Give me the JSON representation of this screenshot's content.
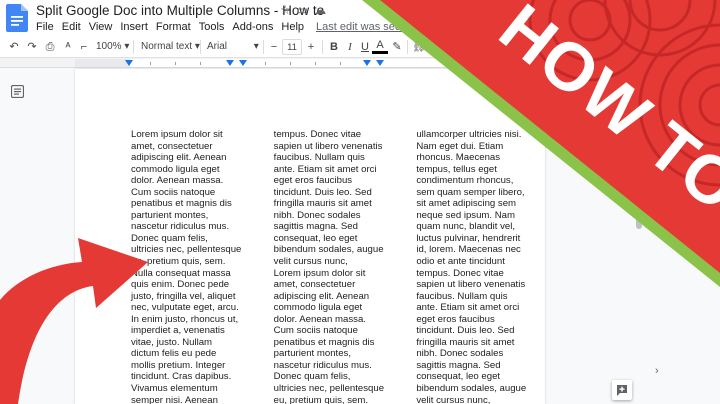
{
  "window": {
    "title": "Split Google Doc into Multiple Columns - How to",
    "star_icon": "star-icon",
    "move_icon": "folder-move-icon",
    "cloud_icon": "cloud-saved-icon"
  },
  "menu": {
    "items": [
      "File",
      "Edit",
      "View",
      "Insert",
      "Format",
      "Tools",
      "Add-ons",
      "Help"
    ],
    "last_edit": "Last edit was seconds ago"
  },
  "toolbar": {
    "zoom": "100%",
    "style": "Normal text",
    "font": "Arial",
    "font_size": "11",
    "minus": "−",
    "plus": "+",
    "bold": "B",
    "italic": "I",
    "underline": "U",
    "text_color": "A"
  },
  "document": {
    "columns": [
      [
        "Lorem ipsum dolor sit",
        "amet, consectetuer",
        "adipiscing elit. Aenean",
        "commodo ligula eget",
        "dolor. Aenean massa.",
        "Cum sociis natoque",
        "penatibus et magnis dis",
        "parturient montes,",
        "nascetur ridiculus mus.",
        "Donec quam felis,",
        "ultricies nec, pellentesque",
        "eu, pretium quis, sem.",
        "Nulla consequat massa",
        "quis enim. Donec pede",
        "justo, fringilla vel, aliquet",
        "nec, vulputate eget, arcu.",
        "In enim justo, rhoncus ut,",
        "imperdiet a, venenatis",
        "vitae, justo. Nullam",
        "dictum felis eu pede",
        "mollis pretium. Integer",
        "tincidunt. Cras dapibus.",
        "Vivamus elementum",
        "semper nisi. Aenean"
      ],
      [
        "tempus. Donec vitae",
        "sapien ut libero venenatis",
        "faucibus. Nullam quis",
        "ante. Etiam sit amet orci",
        "eget eros faucibus",
        "tincidunt. Duis leo. Sed",
        "fringilla mauris sit amet",
        "nibh. Donec sodales",
        "sagittis magna. Sed",
        "consequat, leo eget",
        "bibendum sodales, augue",
        "velit cursus nunc,",
        "Lorem ipsum dolor sit",
        "amet, consectetuer",
        "adipiscing elit. Aenean",
        "commodo ligula eget",
        "dolor. Aenean massa.",
        "Cum sociis natoque",
        "penatibus et magnis dis",
        "parturient montes,",
        "nascetur ridiculus mus.",
        "Donec quam felis,",
        "ultricies nec, pellentesque",
        "eu, pretium quis, sem."
      ],
      [
        "ullamcorper ultricies nisi.",
        "Nam eget dui. Etiam",
        "rhoncus. Maecenas",
        "tempus, tellus eget",
        "condimentum rhoncus,",
        "sem quam semper libero,",
        "sit amet adipiscing sem",
        "neque sed ipsum. Nam",
        "quam nunc, blandit vel,",
        "luctus pulvinar, hendrerit",
        "id, lorem. Maecenas nec",
        "odio et ante tincidunt",
        "tempus. Donec vitae",
        "sapien ut libero venenatis",
        "faucibus. Nullam quis",
        "ante. Etiam sit amet orci",
        "eget eros faucibus",
        "tincidunt. Duis leo. Sed",
        "fringilla mauris sit amet",
        "nibh. Donec sodales",
        "sagittis magna. Sed",
        "consequat, leo eget",
        "bibendum sodales, augue",
        "velit cursus nunc,"
      ]
    ]
  },
  "banner": {
    "text": "HOW TO",
    "bg_color": "#e53935",
    "stripe_color": "#8bc34a",
    "arrow_color": "#e53935"
  }
}
